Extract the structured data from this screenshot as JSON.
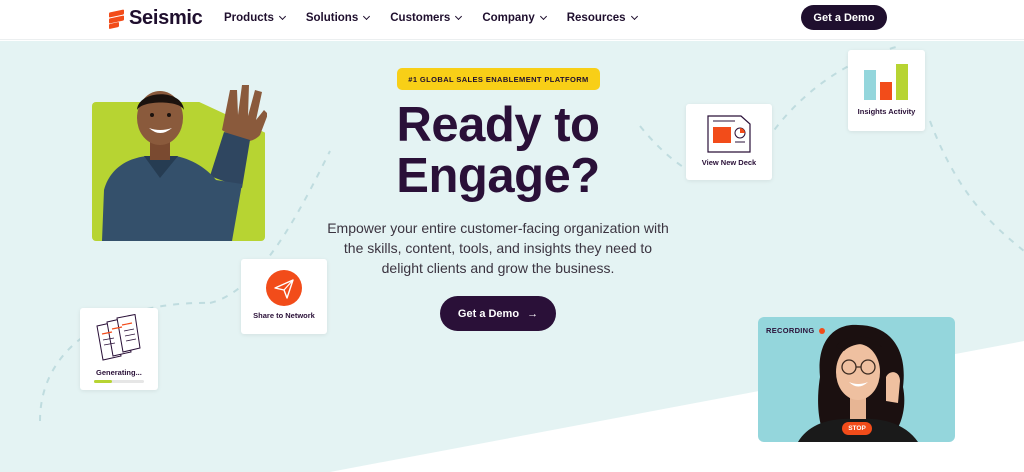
{
  "brand": {
    "name": "Seismic",
    "accent": "#f24c1a",
    "dark": "#2a1038"
  },
  "nav": {
    "items": [
      {
        "label": "Products"
      },
      {
        "label": "Solutions"
      },
      {
        "label": "Customers"
      },
      {
        "label": "Company"
      },
      {
        "label": "Resources"
      }
    ],
    "cta_label": "Get a Demo"
  },
  "hero": {
    "badge": "#1 GLOBAL SALES ENABLEMENT PLATFORM",
    "headline": "Ready to Engage?",
    "subtext": "Empower your entire customer-facing organization with the skills, content, tools, and insights they need to delight clients and grow the business.",
    "cta_label": "Get a Demo",
    "background": "#e4f3f3"
  },
  "cards": {
    "deck": {
      "label": "View New Deck",
      "icon": "presentation-icon"
    },
    "insights": {
      "label": "Insights Activity",
      "icon": "bar-chart-icon"
    },
    "share": {
      "label": "Share to Network",
      "icon": "paper-plane-icon"
    },
    "generating": {
      "label": "Generating...",
      "icon": "documents-icon",
      "progress": 0.35
    }
  },
  "recording": {
    "label": "RECORDING",
    "stop_label": "STOP"
  }
}
